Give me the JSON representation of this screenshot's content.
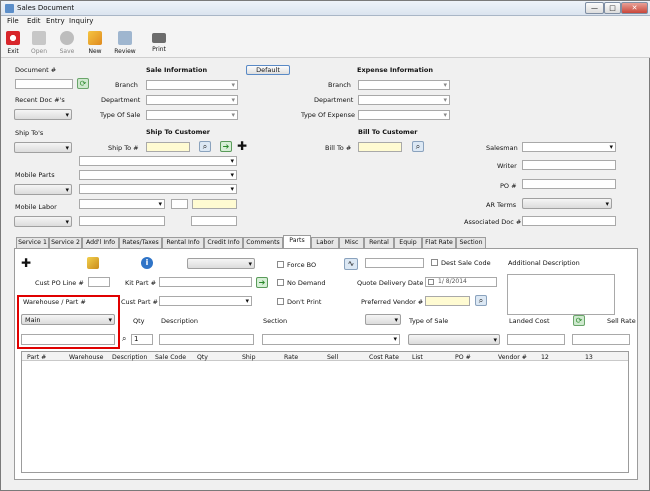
{
  "window": {
    "title": "Sales Document",
    "controls": {
      "minimize": "—",
      "maximize": "□",
      "close": "✕"
    }
  },
  "menu": [
    "File",
    "Edit",
    "Entry",
    "Inquiry"
  ],
  "toolbar": [
    {
      "label": "Exit",
      "icon": "exit-icon"
    },
    {
      "label": "Open",
      "icon": "open-icon"
    },
    {
      "label": "Save",
      "icon": "save-icon"
    },
    {
      "label": "New",
      "icon": "new-icon"
    },
    {
      "label": "Review",
      "icon": "review-icon"
    },
    {
      "label": "Print",
      "icon": "print-icon"
    }
  ],
  "header": {
    "document_label": "Document #",
    "recent_doc_label": "Recent Doc #'s",
    "sale_info_title": "Sale Information",
    "default_button": "Default",
    "branch": "Branch",
    "department": "Department",
    "type_of_sale": "Type Of Sale",
    "expense_info_title": "Expense Information",
    "exp_branch": "Branch",
    "exp_department": "Department",
    "type_of_expense": "Type Of Expense"
  },
  "ship": {
    "ship_tos": "Ship To's",
    "ship_to_customer": "Ship To Customer",
    "ship_to": "Ship To #",
    "bill_to_customer": "Bill To Customer",
    "bill_to": "Bill To #",
    "mobile_parts": "Mobile Parts",
    "mobile_labor": "Mobile Labor"
  },
  "right": {
    "salesman": "Salesman",
    "writer": "Writer",
    "po": "PO #",
    "ar_terms": "AR Terms",
    "associated_doc": "Associated Doc #"
  },
  "tabs": [
    "Service 1",
    "Service 2",
    "Add'l Info",
    "Rates/Taxes",
    "Rental Info",
    "Credit Info",
    "Comments",
    "Parts",
    "Labor",
    "Misc",
    "Rental",
    "Equip",
    "Flat Rate",
    "Section"
  ],
  "active_tab": "Parts",
  "parts": {
    "force_bo": "Force BO",
    "no_demand": "No Demand",
    "dont_print": "Don't Print",
    "dont_print_full": "Don't Print",
    "dest_sale_code": "Dest Sale Code",
    "additional_description": "Additional Description",
    "cust_po_line": "Cust PO Line #",
    "kit_part": "Kit Part #",
    "quote_delivery_date": "Quote Delivery Date",
    "date_value": "1/ 8/2014",
    "warehouse_part": "Warehouse / Part #",
    "cust_part": "Cust Part #",
    "preferred_vendor": "Preferred Vendor #",
    "warehouse_value": "Main",
    "qty_label": "Qty",
    "qty_value": "1",
    "description": "Description",
    "section": "Section",
    "type_of_sale": "Type of Sale",
    "landed_cost": "Landed Cost",
    "sell_rate": "Sell Rate"
  },
  "grid_headers": [
    "Part #",
    "Warehouse",
    "Description",
    "Sale Code",
    "Qty",
    "Ship",
    "Rate",
    "Sell",
    "Cost Rate",
    "List",
    "PO #",
    "Vendor #",
    "12",
    "13"
  ]
}
